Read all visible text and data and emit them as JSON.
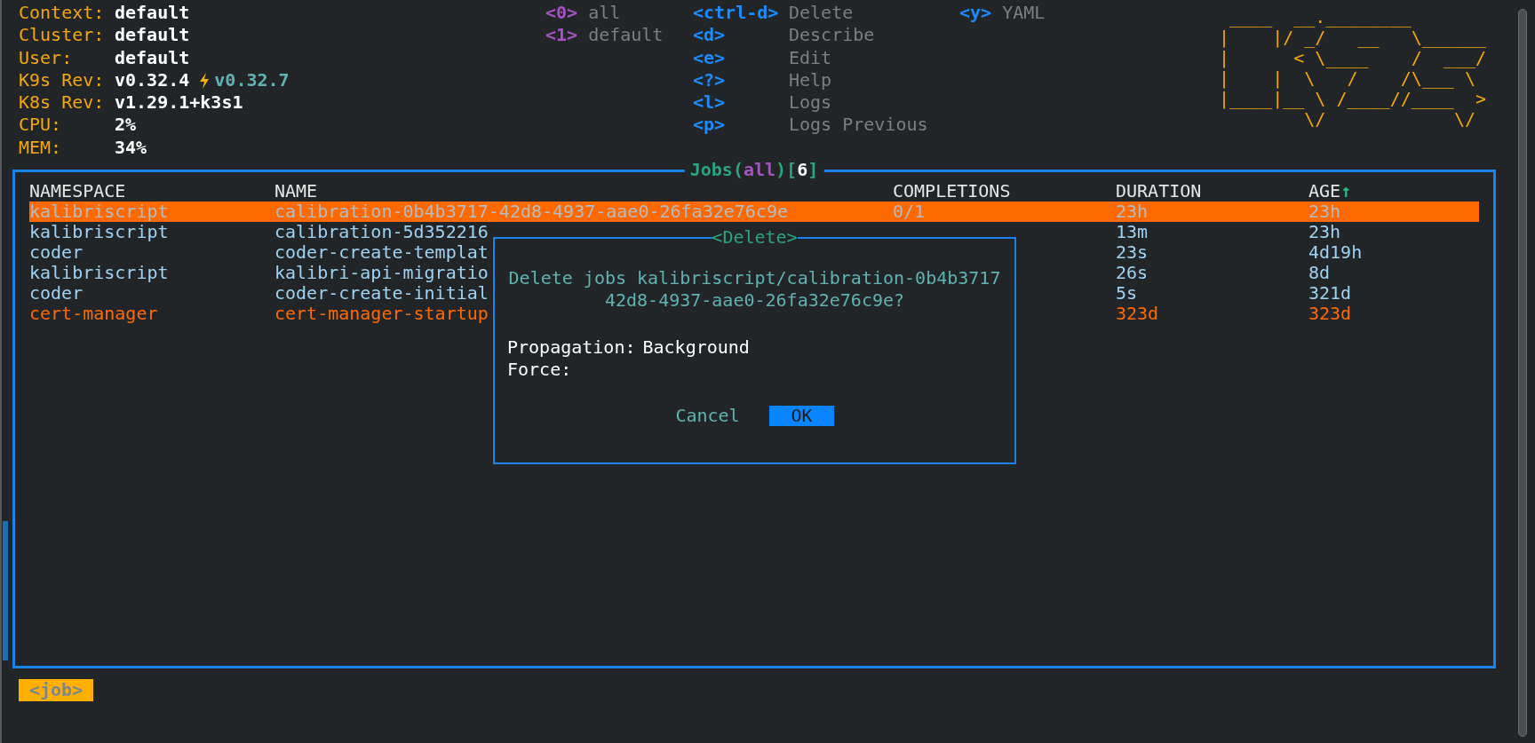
{
  "cluster_info": [
    {
      "label": "Context:",
      "value": "default"
    },
    {
      "label": "Cluster:",
      "value": "default"
    },
    {
      "label": "User:",
      "value": "default"
    },
    {
      "label": "K9s Rev:",
      "value": "v0.32.4",
      "update": "v0.32.7"
    },
    {
      "label": "K8s Rev:",
      "value": "v1.29.1+k3s1"
    },
    {
      "label": "CPU:",
      "value": "2%"
    },
    {
      "label": "MEM:",
      "value": "34%"
    }
  ],
  "shortcut_columns": [
    [
      {
        "kind": "namespace",
        "key": "<0>",
        "label": "all"
      },
      {
        "kind": "namespace",
        "key": "<1>",
        "label": "default"
      }
    ],
    [
      {
        "kind": "action",
        "key": "<ctrl-d>",
        "label": "Delete"
      },
      {
        "kind": "action",
        "key": "<d>",
        "label": "Describe"
      },
      {
        "kind": "action",
        "key": "<e>",
        "label": "Edit"
      },
      {
        "kind": "action",
        "key": "<?>",
        "label": "Help"
      },
      {
        "kind": "action",
        "key": "<l>",
        "label": "Logs"
      },
      {
        "kind": "action",
        "key": "<p>",
        "label": "Logs Previous"
      }
    ],
    [
      {
        "kind": "action",
        "key": "<y>",
        "label": "YAML"
      }
    ]
  ],
  "logo_lines": [
    " ____  __.________       ",
    "|    |/ _/   __   \\______",
    "|      < \\____    /  ___/",
    "|    |  \\   /    /\\___ \\ ",
    "|____|__ \\ /____//____  >",
    "        \\/            \\/ "
  ],
  "table": {
    "title": [
      {
        "kind": "plain",
        "text": "Jobs("
      },
      {
        "kind": "namespace",
        "text": "all"
      },
      {
        "kind": "plain",
        "text": ")["
      },
      {
        "kind": "count",
        "text": "6"
      },
      {
        "kind": "plain",
        "text": "]"
      }
    ],
    "columns": [
      {
        "label": "NAMESPACE"
      },
      {
        "label": "NAME"
      },
      {
        "label": "COMPLETIONS"
      },
      {
        "label": "DURATION"
      },
      {
        "label": "AGE",
        "sort_arrow": "↑"
      }
    ],
    "rows": [
      {
        "namespace": "kalibriscript",
        "name": "calibration-0b4b3717-42d8-4937-aae0-26fa32e76c9e",
        "completions": "0/1",
        "duration": "23h",
        "age": "23h",
        "selected": true
      },
      {
        "namespace": "kalibriscript",
        "name": "calibration-5d352216",
        "duration": "13m",
        "age": "23h",
        "selected": false,
        "color": "#9dd2f3"
      },
      {
        "namespace": "coder",
        "name": "coder-create-templat",
        "duration": "23s",
        "age": "4d19h",
        "selected": false,
        "color": "#9dd2f3"
      },
      {
        "namespace": "kalibriscript",
        "name": "kalibri-api-migratio",
        "duration": "26s",
        "age": "8d",
        "selected": false,
        "color": "#9dd2f3"
      },
      {
        "namespace": "coder",
        "name": "coder-create-initial",
        "duration": "5s",
        "age": "321d",
        "selected": false,
        "color": "#9dd2f3"
      },
      {
        "namespace": "cert-manager",
        "name": "cert-manager-startup",
        "duration": "323d",
        "age": "323d",
        "selected": false,
        "color": "#ff6a00"
      }
    ]
  },
  "dialog": {
    "title": "<Delete>",
    "message_lines": [
      "Delete jobs kalibriscript/calibration-0b4b3717",
      "42d8-4937-aae0-26fa32e76c9e?"
    ],
    "fields": [
      {
        "label": "Propagation:",
        "value": "Background"
      },
      {
        "label": "Force:"
      }
    ],
    "buttons": [
      {
        "label": "Cancel",
        "selected": false
      },
      {
        "label": "OK",
        "selected": true
      }
    ]
  },
  "breadcrumb": "<job>"
}
